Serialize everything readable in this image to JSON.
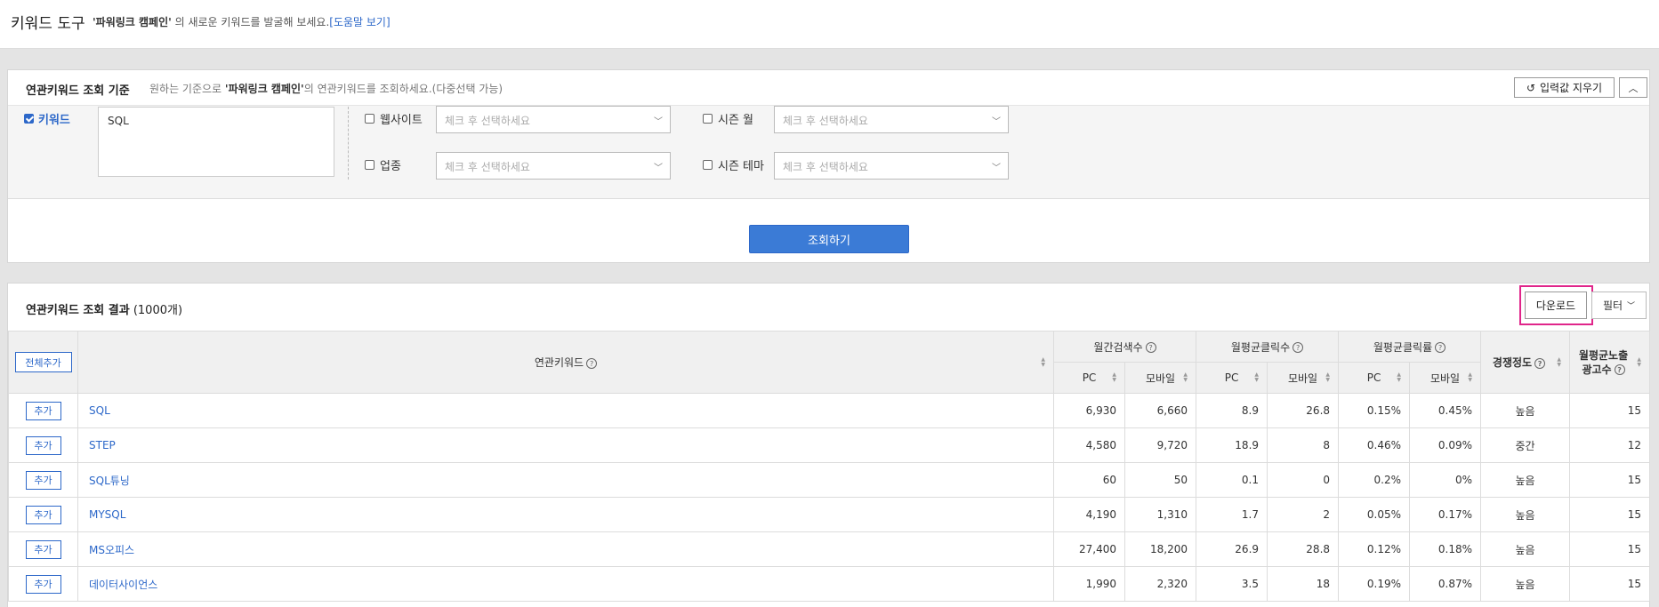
{
  "page": {
    "title": "키워드 도구",
    "subtitle_campaign": "'파워링크 캠페인'",
    "subtitle_text": " 의 새로운 키워드를 발굴해 보세요.",
    "help_link": "[도움말 보기]"
  },
  "query_panel": {
    "title": "연관키워드 조회 기준",
    "desc_prefix": "원하는 기준으로 ",
    "desc_campaign": "'파워링크 캠페인'",
    "desc_suffix": "의 연관키워드를 조회하세요.(다중선택 가능)",
    "clear_button": "입력값 지우기",
    "keyword_label": "키워드",
    "keyword_value": "SQL",
    "website_label": "웹사이트",
    "industry_label": "업종",
    "season_month_label": "시즌 월",
    "season_theme_label": "시즌 테마",
    "select_placeholder": "체크 후 선택하세요",
    "search_button": "조회하기"
  },
  "results_panel": {
    "title": "연관키워드 조회 결과",
    "count": "(1000개)",
    "download_button": "다운로드",
    "filter_button": "필터",
    "add_all_button": "전체추가",
    "columns": {
      "keyword": "연관키워드",
      "monthly_search": "월간검색수",
      "avg_clicks": "월평균클릭수",
      "avg_ctr": "월평균클릭률",
      "competition": "경쟁정도",
      "avg_ads_line1": "월평균노출",
      "avg_ads_line2": "광고수",
      "pc": "PC",
      "mobile": "모바일"
    },
    "add_button": "추가",
    "rows": [
      {
        "keyword": "SQL",
        "search_pc": "6,930",
        "search_mobile": "6,660",
        "clicks_pc": "8.9",
        "clicks_mobile": "26.8",
        "ctr_pc": "0.15%",
        "ctr_mobile": "0.45%",
        "competition": "높음",
        "ads": "15"
      },
      {
        "keyword": "STEP",
        "search_pc": "4,580",
        "search_mobile": "9,720",
        "clicks_pc": "18.9",
        "clicks_mobile": "8",
        "ctr_pc": "0.46%",
        "ctr_mobile": "0.09%",
        "competition": "중간",
        "ads": "12"
      },
      {
        "keyword": "SQL튜닝",
        "search_pc": "60",
        "search_mobile": "50",
        "clicks_pc": "0.1",
        "clicks_mobile": "0",
        "ctr_pc": "0.2%",
        "ctr_mobile": "0%",
        "competition": "높음",
        "ads": "15"
      },
      {
        "keyword": "MYSQL",
        "search_pc": "4,190",
        "search_mobile": "1,310",
        "clicks_pc": "1.7",
        "clicks_mobile": "2",
        "ctr_pc": "0.05%",
        "ctr_mobile": "0.17%",
        "competition": "높음",
        "ads": "15"
      },
      {
        "keyword": "MS오피스",
        "search_pc": "27,400",
        "search_mobile": "18,200",
        "clicks_pc": "26.9",
        "clicks_mobile": "28.8",
        "ctr_pc": "0.12%",
        "ctr_mobile": "0.18%",
        "competition": "높음",
        "ads": "15"
      },
      {
        "keyword": "데이터사이언스",
        "search_pc": "1,990",
        "search_mobile": "2,320",
        "clicks_pc": "3.5",
        "clicks_mobile": "18",
        "ctr_pc": "0.19%",
        "ctr_mobile": "0.87%",
        "competition": "높음",
        "ads": "15"
      }
    ]
  },
  "colors": {
    "accent": "#2d68c9",
    "search_button": "#3b7bd6",
    "highlight_box": "#e0258a"
  },
  "icons": [
    "checkbox-checked-icon",
    "checkbox-icon",
    "chevron-down-icon",
    "refresh-icon",
    "chevron-up-icon",
    "help-icon",
    "sort-icon"
  ]
}
